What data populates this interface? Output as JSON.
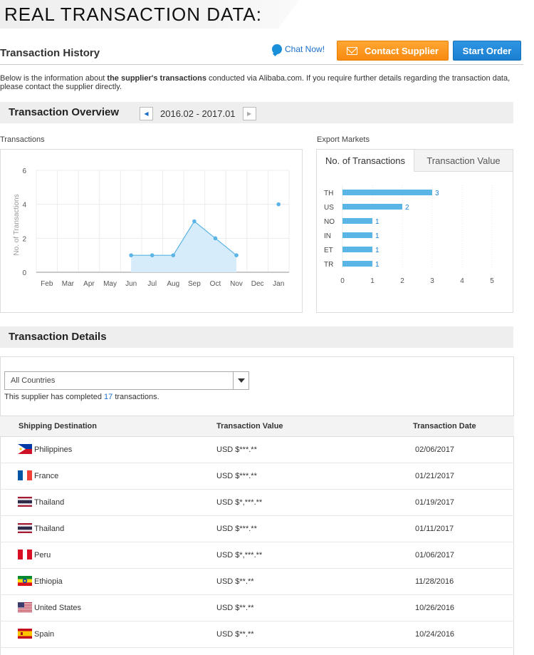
{
  "banner": {
    "title": "REAL TRANSACTION DATA:"
  },
  "header": {
    "title": "Transaction History",
    "chat_label": "Chat Now!",
    "contact_label": "Contact Supplier",
    "start_order_label": "Start Order"
  },
  "intro": {
    "text_before": "Below is the information about ",
    "bold": "the supplier's transactions",
    "text_after": " conducted via Alibaba.com. If you require further details regarding the transaction data, please contact the supplier directly."
  },
  "overview": {
    "title": "Transaction Overview",
    "period": "2016.02 - 2017.01"
  },
  "transactions_chart_label": "Transactions",
  "export_markets_label": "Export Markets",
  "export_tabs": [
    "No. of Transactions",
    "Transaction Value"
  ],
  "chart_data": [
    {
      "type": "area",
      "ylabel": "No. of Transactions",
      "categories": [
        "Feb",
        "Mar",
        "Apr",
        "May",
        "Jun",
        "Jul",
        "Aug",
        "Sep",
        "Oct",
        "Nov",
        "Dec",
        "Jan"
      ],
      "values": [
        null,
        null,
        null,
        null,
        1,
        1,
        1,
        3,
        2,
        1,
        null,
        4
      ],
      "ylim": [
        0,
        6
      ],
      "yticks": [
        0,
        2,
        4,
        6
      ],
      "grid": true,
      "color": "#5ab4e5",
      "fill": "#d6ecfa"
    },
    {
      "type": "bar",
      "orientation": "horizontal",
      "categories": [
        "TH",
        "US",
        "NO",
        "IN",
        "ET",
        "TR"
      ],
      "values": [
        3,
        2,
        1,
        1,
        1,
        1
      ],
      "xlim": [
        0,
        5
      ],
      "xticks": [
        0,
        1,
        2,
        3,
        4,
        5
      ],
      "grid": true,
      "color": "#5ab4e5"
    }
  ],
  "details": {
    "title": "Transaction Details",
    "country_select": "All Countries",
    "completed_before": "This supplier has completed ",
    "completed_count": "17",
    "completed_after": " transactions.",
    "columns": [
      "Shipping Destination",
      "Transaction Value",
      "Transaction Date"
    ],
    "rows": [
      {
        "country": "Philippines",
        "flag": "philippines-flag-icon",
        "value": "USD $***.**",
        "date": "02/06/2017"
      },
      {
        "country": "France",
        "flag": "france-flag-icon",
        "value": "USD $***.**",
        "date": "01/21/2017"
      },
      {
        "country": "Thailand",
        "flag": "thailand-flag-icon",
        "value": "USD $*,***.**",
        "date": "01/19/2017"
      },
      {
        "country": "Thailand",
        "flag": "thailand-flag-icon",
        "value": "USD $***.**",
        "date": "01/11/2017"
      },
      {
        "country": "Peru",
        "flag": "peru-flag-icon",
        "value": "USD $*,***.**",
        "date": "01/06/2017"
      },
      {
        "country": "Ethiopia",
        "flag": "ethiopia-flag-icon",
        "value": "USD $**.**",
        "date": "11/28/2016"
      },
      {
        "country": "United States",
        "flag": "united-states-flag-icon",
        "value": "USD $**.**",
        "date": "10/26/2016"
      },
      {
        "country": "Spain",
        "flag": "spain-flag-icon",
        "value": "USD $**.**",
        "date": "10/24/2016"
      }
    ]
  },
  "colors": {
    "accent_orange": "#f98a10",
    "accent_blue": "#1a7fd0",
    "link": "#1a6fc9",
    "chart": "#5ab4e5"
  }
}
